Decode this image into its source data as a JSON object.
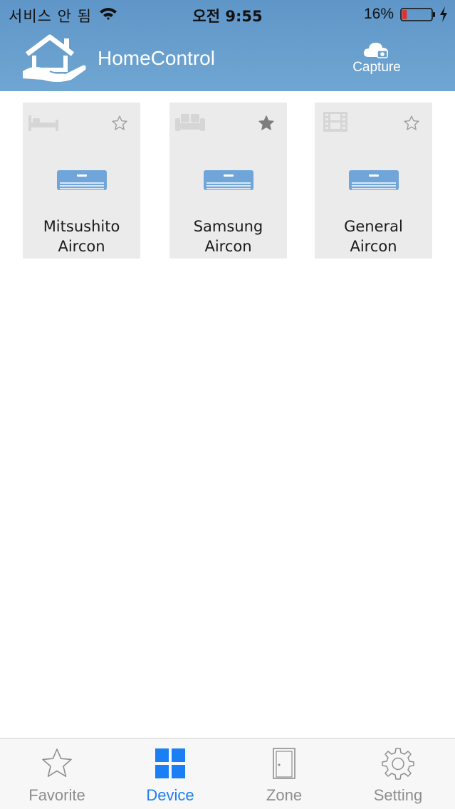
{
  "status_bar": {
    "carrier": "서비스 안 됨",
    "time": "오전 9:55",
    "battery_percent": "16%",
    "battery_level": 0.16
  },
  "header": {
    "app_title": "HomeControl",
    "capture_label": "Capture",
    "background_color": "#6a9fce"
  },
  "devices": [
    {
      "name_line1": "Mitsushito",
      "name_line2": "Aircon",
      "room_icon": "bed-icon",
      "device_icon": "aircon-icon",
      "favorite": false
    },
    {
      "name_line1": "Samsung",
      "name_line2": "Aircon",
      "room_icon": "sofa-icon",
      "device_icon": "aircon-icon",
      "favorite": true
    },
    {
      "name_line1": "General",
      "name_line2": "Aircon",
      "room_icon": "film-icon",
      "device_icon": "aircon-icon",
      "favorite": false
    }
  ],
  "tabs": [
    {
      "label": "Favorite",
      "icon": "star-icon",
      "active": false
    },
    {
      "label": "Device",
      "icon": "grid-icon",
      "active": true
    },
    {
      "label": "Zone",
      "icon": "door-icon",
      "active": false
    },
    {
      "label": "Setting",
      "icon": "gear-icon",
      "active": false
    }
  ],
  "colors": {
    "accent": "#1a7ef5",
    "inactive_tab": "#8e8e8e",
    "card_bg": "#ebebeb",
    "aircon_blue": "#6fa5d9"
  }
}
